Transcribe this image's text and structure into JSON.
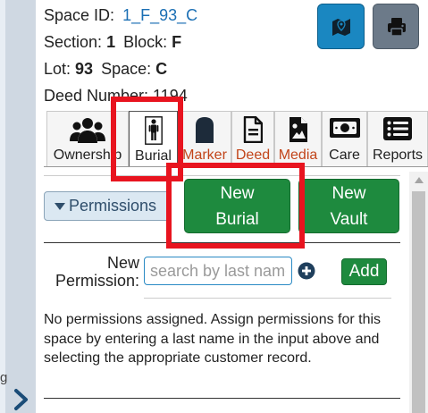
{
  "header": {
    "space_id_label": "Space ID:",
    "space_id_value": "1_F_93_C",
    "section_label": "Section:",
    "section_value": "1",
    "block_label": "Block:",
    "block_value": "F",
    "lot_label": "Lot:",
    "lot_value": "93",
    "space_label": "Space:",
    "space_value": "C",
    "deed_line": "Deed Number: 1194"
  },
  "toolbar": {
    "map_icon": "map-icon",
    "print_icon": "print-icon"
  },
  "tabs": [
    {
      "label": "Ownership",
      "icon": "users-icon",
      "active": false
    },
    {
      "label": "Burial",
      "icon": "person-icon",
      "active": true
    },
    {
      "label": "Marker",
      "icon": "headstone-icon",
      "active": false
    },
    {
      "label": "Deed",
      "icon": "document-icon",
      "active": false
    },
    {
      "label": "Media",
      "icon": "image-icon",
      "active": false
    },
    {
      "label": "Care",
      "icon": "money-icon",
      "active": false
    },
    {
      "label": "Reports",
      "icon": "list-icon",
      "active": false
    }
  ],
  "permissions": {
    "toggle_label": "Permissions",
    "new_burial_line1": "New",
    "new_burial_line2": "Burial",
    "new_vault_line1": "New",
    "new_vault_line2": "Vault",
    "new_permission_line1": "New",
    "new_permission_line2": "Permission:",
    "search_placeholder": "search by last name",
    "search_value": "",
    "add_label": "Add",
    "empty_message": "No permissions assigned. Assign permissions for this space by entering a last name in the input above and selecting the appropriate customer record."
  },
  "sidebar": {
    "edge_text": "g",
    "expand_icon": "chevron-right-icon"
  },
  "colors": {
    "link": "#1b6fb4",
    "primary_button": "#1a87c1",
    "secondary_button": "#6c7a89",
    "success": "#1e8a3e",
    "highlight": "#e8141f",
    "tab_accent": "#c2451a"
  }
}
